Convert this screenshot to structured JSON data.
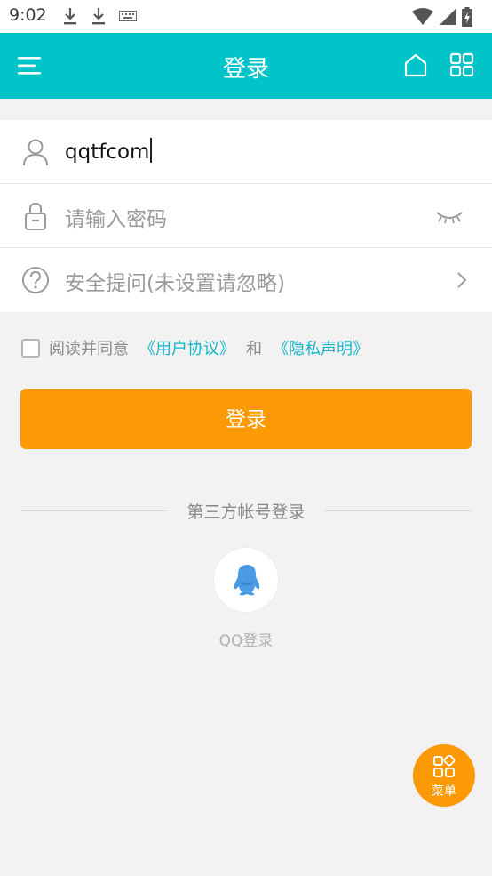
{
  "status_bar": {
    "time": "9:02"
  },
  "app_bar": {
    "title": "登录"
  },
  "form": {
    "username_value": "qqtfcom",
    "password_placeholder": "请输入密码",
    "security_question_placeholder": "安全提问(未设置请忽略)"
  },
  "agreement": {
    "prefix": "阅读并同意",
    "user_agreement": "《用户协议》",
    "conjunction": "和",
    "privacy_policy": "《隐私声明》"
  },
  "login_button": {
    "label": "登录"
  },
  "third_party": {
    "heading": "第三方帐号登录",
    "qq_label": "QQ登录"
  },
  "fab": {
    "label": "菜单"
  },
  "colors": {
    "app_bar": "#00c4c7",
    "primary_button": "#fb9a04",
    "link": "#15b4c9",
    "background": "#f2f2f2"
  },
  "icons": [
    "download-icon",
    "keyboard-icon",
    "wifi-icon",
    "signal-icon",
    "battery-icon",
    "menu-icon",
    "home-icon",
    "apps-grid-icon",
    "user-icon",
    "lock-icon",
    "eye-closed-icon",
    "question-circle-icon",
    "chevron-right-icon",
    "qq-penguin-icon",
    "menu-grid-icon"
  ]
}
